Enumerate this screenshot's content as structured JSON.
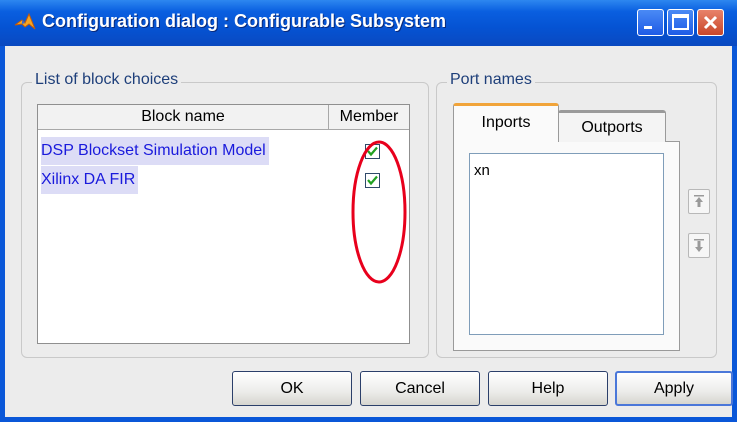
{
  "window": {
    "title": "Configuration dialog : Configurable Subsystem",
    "icon": "matlab-logo-icon",
    "controls": [
      "minimize-icon",
      "maximize-icon",
      "close-icon"
    ]
  },
  "block_choices": {
    "group_label": "List of block choices",
    "columns": [
      "Block name",
      "Member"
    ],
    "rows": [
      {
        "name": "DSP Blockset Simulation Model",
        "member": true
      },
      {
        "name": "Xilinx DA FIR",
        "member": true
      }
    ],
    "annotation_color": "#e8001c"
  },
  "port_names": {
    "group_label": "Port names",
    "tabs": [
      "Inports",
      "Outports"
    ],
    "active_tab": "Inports",
    "ports": [
      "xn"
    ],
    "move_up_icon": "move-up-icon",
    "move_down_icon": "move-down-icon"
  },
  "buttons": {
    "ok": "OK",
    "cancel": "Cancel",
    "help": "Help",
    "apply": "Apply"
  },
  "colors": {
    "titlebar": "#0a5fe0",
    "link_text": "#1a1adc",
    "active_tab_accent": "#f1a43a"
  }
}
